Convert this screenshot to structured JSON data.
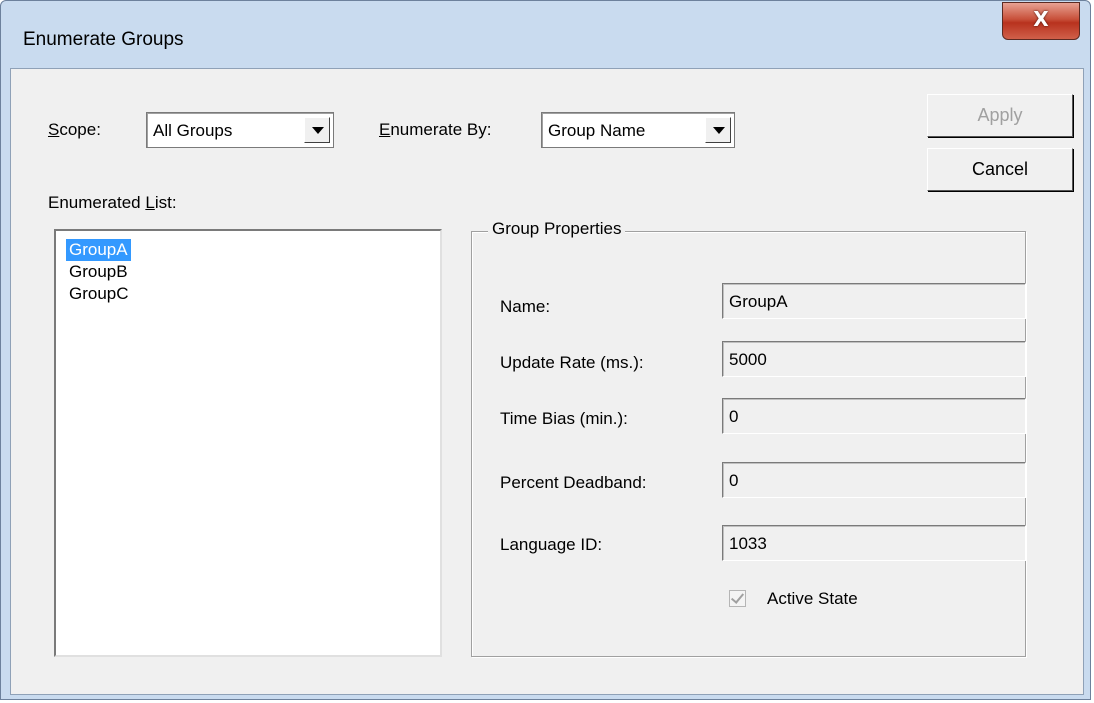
{
  "window": {
    "title": "Enumerate Groups",
    "close_label": "X"
  },
  "scope": {
    "label_prefix": "",
    "label_underline": "S",
    "label_rest": "cope:",
    "value": "All Groups"
  },
  "enumerate_by": {
    "label_underline": "E",
    "label_rest": "numerate By:",
    "value": "Group Name"
  },
  "buttons": {
    "apply": "Apply",
    "cancel": "Cancel"
  },
  "enumerated_list": {
    "label_prefix": "Enumerated ",
    "label_underline": "L",
    "label_rest": "ist:",
    "items": [
      "GroupA",
      "GroupB",
      "GroupC"
    ],
    "selected_index": 0
  },
  "group_properties": {
    "title": "Group Properties",
    "fields": [
      {
        "label": "Name:",
        "value": "GroupA"
      },
      {
        "label": "Update Rate (ms.):",
        "value": "5000"
      },
      {
        "label": "Time Bias (min.):",
        "value": "0"
      },
      {
        "label": "Percent Deadband:",
        "value": "0"
      },
      {
        "label": "Language ID:",
        "value": "1033"
      }
    ],
    "active_state": {
      "label": "Active State",
      "checked": true,
      "enabled": false
    }
  },
  "colors": {
    "selection": "#3399ff",
    "dialog_bg": "#f0f0f0",
    "frame": "#c9dbef",
    "close_button": "#c8503a"
  }
}
